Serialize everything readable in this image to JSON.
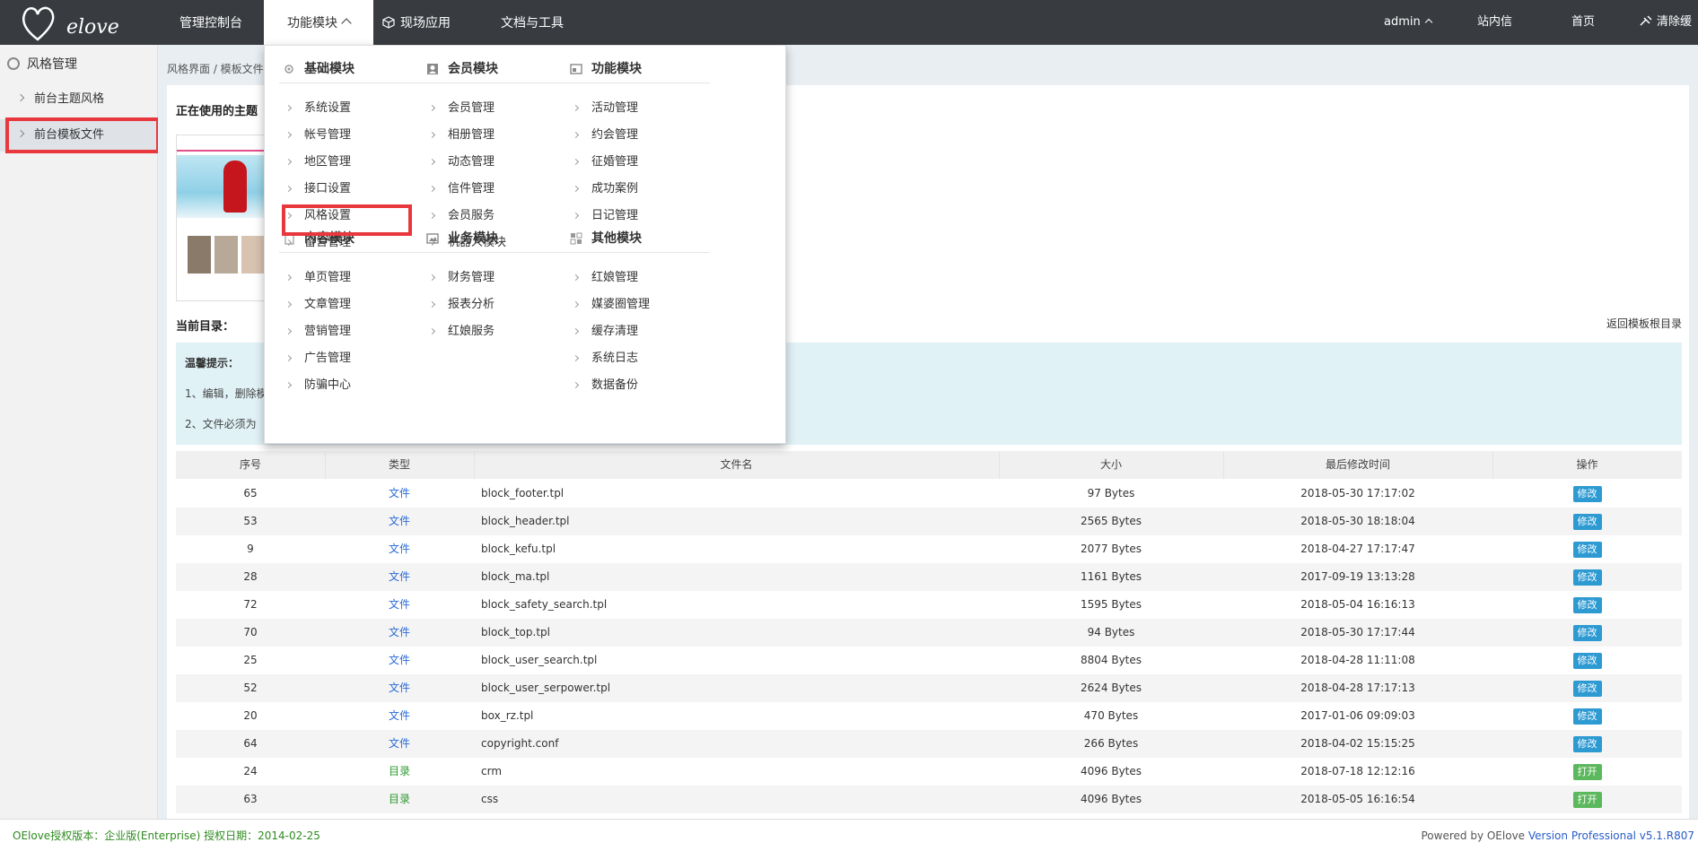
{
  "topbar": {
    "logo_text": "elove",
    "nav": [
      "管理控制台",
      "功能模块",
      "现场应用",
      "文档与工具"
    ],
    "user": "admin",
    "links": [
      "站内信",
      "首页",
      "清除缓存"
    ]
  },
  "sidebar": {
    "title": "风格管理",
    "items": [
      "前台主题风格",
      "前台模板文件"
    ]
  },
  "breadcrumb": "风格界面 / 模板文件",
  "theme": {
    "title": "正在使用的主题"
  },
  "current_dir": {
    "label": "当前目录：",
    "back": "返回模板根目录"
  },
  "tips": {
    "title": "温馨提示：",
    "line1": "1、编辑，删除模",
    "line2": "2、文件必须为"
  },
  "table": {
    "headers": [
      "序号",
      "类型",
      "文件名",
      "大小",
      "最后修改时间",
      "操作"
    ],
    "rows": [
      [
        "65",
        "文件",
        "block_footer.tpl",
        "97 Bytes",
        "2018-05-30 17:17:02",
        "修改"
      ],
      [
        "53",
        "文件",
        "block_header.tpl",
        "2565 Bytes",
        "2018-05-30 18:18:04",
        "修改"
      ],
      [
        "9",
        "文件",
        "block_kefu.tpl",
        "2077 Bytes",
        "2018-04-27 17:17:47",
        "修改"
      ],
      [
        "28",
        "文件",
        "block_ma.tpl",
        "1161 Bytes",
        "2017-09-19 13:13:28",
        "修改"
      ],
      [
        "72",
        "文件",
        "block_safety_search.tpl",
        "1595 Bytes",
        "2018-05-04 16:16:13",
        "修改"
      ],
      [
        "70",
        "文件",
        "block_top.tpl",
        "94 Bytes",
        "2018-05-30 17:17:44",
        "修改"
      ],
      [
        "25",
        "文件",
        "block_user_search.tpl",
        "8804 Bytes",
        "2018-04-28 11:11:08",
        "修改"
      ],
      [
        "52",
        "文件",
        "block_user_serpower.tpl",
        "2624 Bytes",
        "2018-04-28 17:17:13",
        "修改"
      ],
      [
        "20",
        "文件",
        "box_rz.tpl",
        "470 Bytes",
        "2017-01-06 09:09:03",
        "修改"
      ],
      [
        "64",
        "文件",
        "copyright.conf",
        "266 Bytes",
        "2018-04-02 15:15:25",
        "修改"
      ],
      [
        "24",
        "目录",
        "crm",
        "4096 Bytes",
        "2018-07-18 12:12:16",
        "打开"
      ],
      [
        "63",
        "目录",
        "css",
        "4096 Bytes",
        "2018-05-05 16:16:54",
        "打开"
      ]
    ]
  },
  "footer": {
    "left": "OElove授权版本：企业版(Enterprise) 授权日期：2014-02-25",
    "right_prefix": "Powered by OElove ",
    "right_version": "Version Professional v5.1.R807"
  },
  "dropdown": {
    "groups": [
      {
        "title": "基础模块",
        "icon": "gear-icon",
        "items": [
          "系统设置",
          "帐号管理",
          "地区管理",
          "接口设置",
          "风格设置",
          "留言管理"
        ]
      },
      {
        "title": "会员模块",
        "icon": "user-icon",
        "items": [
          "会员管理",
          "相册管理",
          "动态管理",
          "信件管理",
          "会员服务",
          "机器人模块"
        ]
      },
      {
        "title": "功能模块",
        "icon": "window-icon",
        "items": [
          "活动管理",
          "约会管理",
          "征婚管理",
          "成功案例",
          "日记管理"
        ]
      },
      {
        "title": "内容模块",
        "icon": "document-icon",
        "items": [
          "单页管理",
          "文章管理",
          "营销管理",
          "广告管理",
          "防骗中心"
        ]
      },
      {
        "title": "业务模块",
        "icon": "image-icon",
        "items": [
          "财务管理",
          "报表分析",
          "红娘服务"
        ]
      },
      {
        "title": "其他模块",
        "icon": "grid-icon",
        "items": [
          "红娘管理",
          "媒婆圈管理",
          "缓存清理",
          "系统日志",
          "数据备份"
        ]
      }
    ]
  },
  "colors": {
    "topbar": "#383c41",
    "highlight": "#e8383d",
    "edit_button": "#2d9ad2",
    "open_button": "#5cb85c",
    "file_type": "#2a6ad4",
    "dir_type": "#2e9a32"
  }
}
